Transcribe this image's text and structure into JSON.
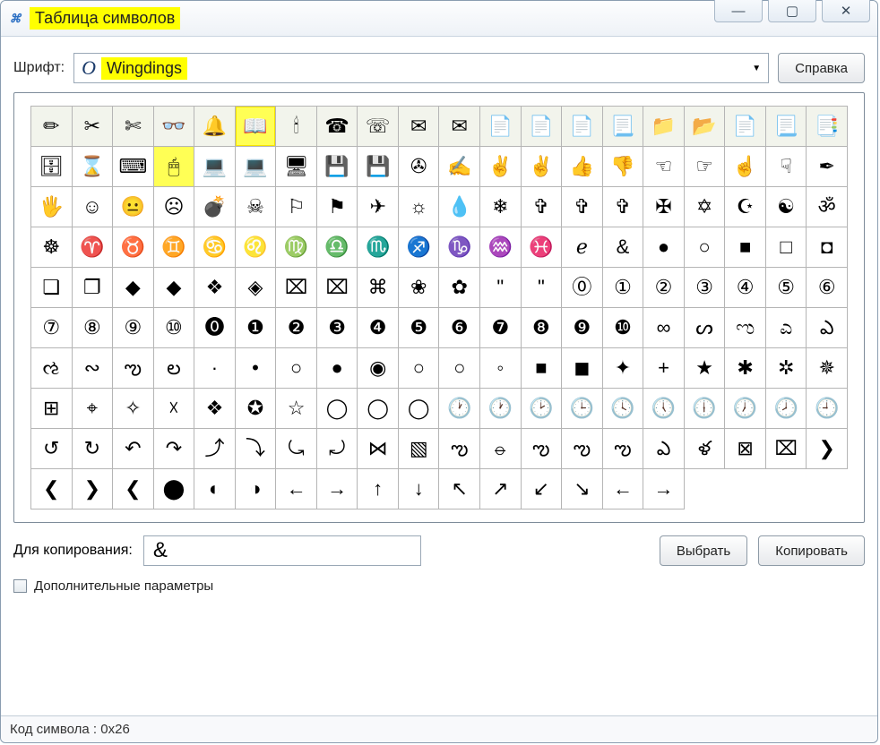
{
  "window": {
    "title": "Таблица символов"
  },
  "fontrow": {
    "label": "Шрифт:",
    "fontname": "Wingdings",
    "help_btn": "Справка"
  },
  "grid": {
    "selected_index": 5,
    "highlight2_index": 23,
    "chars": [
      "✏",
      "✂",
      "✄",
      "👓",
      "🔔",
      "📖",
      "🕯",
      "☎",
      "☏",
      "✉",
      "✉",
      "📄",
      "📄",
      "📄",
      "📃",
      "📁",
      "📂",
      "📄",
      "📃",
      "📑",
      "🗄",
      "⌛",
      "⌨",
      "🖱",
      "💻",
      "💻",
      "🖥",
      "💾",
      "💾",
      "✇",
      "✍",
      "✌",
      "✌",
      "👍",
      "👎",
      "☜",
      "☞",
      "☝",
      "☟",
      "✒",
      "🖐",
      "☺",
      "😐",
      "☹",
      "💣",
      "☠",
      "⚐",
      "⚑",
      "✈",
      "☼",
      "💧",
      "❄",
      "✞",
      "✞",
      "✞",
      "✠",
      "✡",
      "☪",
      "☯",
      "ॐ",
      "☸",
      "♈",
      "♉",
      "♊",
      "♋",
      "♌",
      "♍",
      "♎",
      "♏",
      "♐",
      "♑",
      "♒",
      "♓",
      "ℯ",
      "&",
      "●",
      "○",
      "■",
      "□",
      "◘",
      "❏",
      "❐",
      "◆",
      "◆",
      "❖",
      "◈",
      "⌧",
      "⌧",
      "⌘",
      "❀",
      "✿",
      "\"",
      "\"",
      "⓪",
      "①",
      "②",
      "③",
      "④",
      "⑤",
      "⑥",
      "⑦",
      "⑧",
      "⑨",
      "⑩",
      "⓿",
      "❶",
      "❷",
      "❸",
      "❹",
      "❺",
      "❻",
      "❼",
      "❽",
      "❾",
      "❿",
      "∞",
      "ᔕ",
      "ಌ",
      "ಎ",
      "ఎ",
      "ઌ",
      "∾",
      "ఌ",
      "ల",
      "·",
      "•",
      "○",
      "●",
      "◉",
      "○",
      "○",
      "◦",
      "■",
      "◼",
      "✦",
      "+",
      "★",
      "✱",
      "✲",
      "✵",
      "⊞",
      "⌖",
      "✧",
      "☓",
      "❖",
      "✪",
      "☆",
      "◯",
      "◯",
      "◯",
      "🕐",
      "🕐",
      "🕑",
      "🕒",
      "🕓",
      "🕔",
      "🕕",
      "🕖",
      "🕗",
      "🕘",
      "↺",
      "↻",
      "↶",
      "↷",
      "⤴",
      "⤵",
      "⤿",
      "⤾",
      "⋈",
      "▧",
      "ఌ",
      "⦵",
      "ఌ",
      "ఌ",
      "ఌ",
      "ఎ",
      "ళ",
      "⊠",
      "⌧",
      "❯",
      "❮",
      "❯",
      "❮",
      "⬤",
      "◐",
      "◑",
      "←",
      "→",
      "↑",
      "↓",
      "↖",
      "↗",
      "↙",
      "↘",
      "←",
      "→"
    ]
  },
  "copy": {
    "label": "Для копирования:",
    "value": "&",
    "select_btn": "Выбрать",
    "copy_btn": "Копировать"
  },
  "advanced": {
    "label": "Дополнительные параметры"
  },
  "status": {
    "text": "Код символа : 0x26"
  }
}
